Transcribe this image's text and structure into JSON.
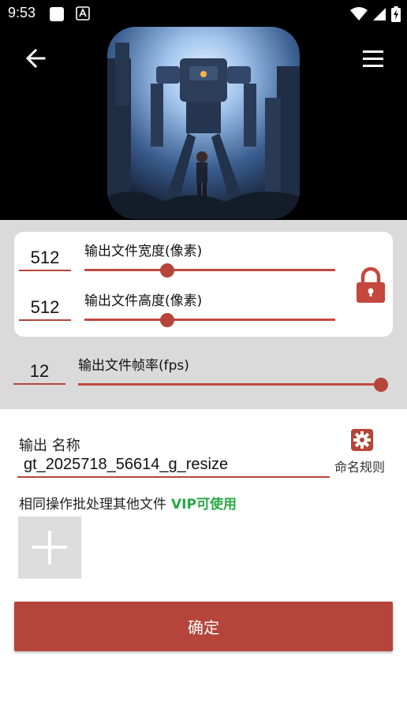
{
  "status_bar": {
    "time": "9:53",
    "icons": [
      "square-icon",
      "a-badge-icon",
      "wifi-icon",
      "signal-icon",
      "battery-charging-icon"
    ]
  },
  "header": {
    "back_icon": "arrow-left-icon",
    "menu_icon": "hamburger-menu-icon"
  },
  "size": {
    "width_value": "512",
    "width_label": "输出文件宽度(像素)",
    "width_slider_value": 0.25,
    "height_value": "512",
    "height_label": "输出文件高度(像素)",
    "height_slider_value": 0.25,
    "lock_icon": "lock-icon"
  },
  "fps": {
    "value": "12",
    "label": "输出文件帧率(fps)",
    "slider_value": 1.0
  },
  "output": {
    "label": "输出 名称",
    "filename": "gt_2025718_56614_g_resize",
    "naming_rule_label": "命名规则",
    "naming_rule_icon": "gear-icon"
  },
  "batch": {
    "label": "相同操作批处理其他文件",
    "vip_label": "VIP可使用",
    "add_icon": "plus-icon"
  },
  "confirm_label": "确定",
  "colors": {
    "accent": "#b5453b",
    "vip": "#28a745",
    "panel_bg": "#dadada"
  }
}
